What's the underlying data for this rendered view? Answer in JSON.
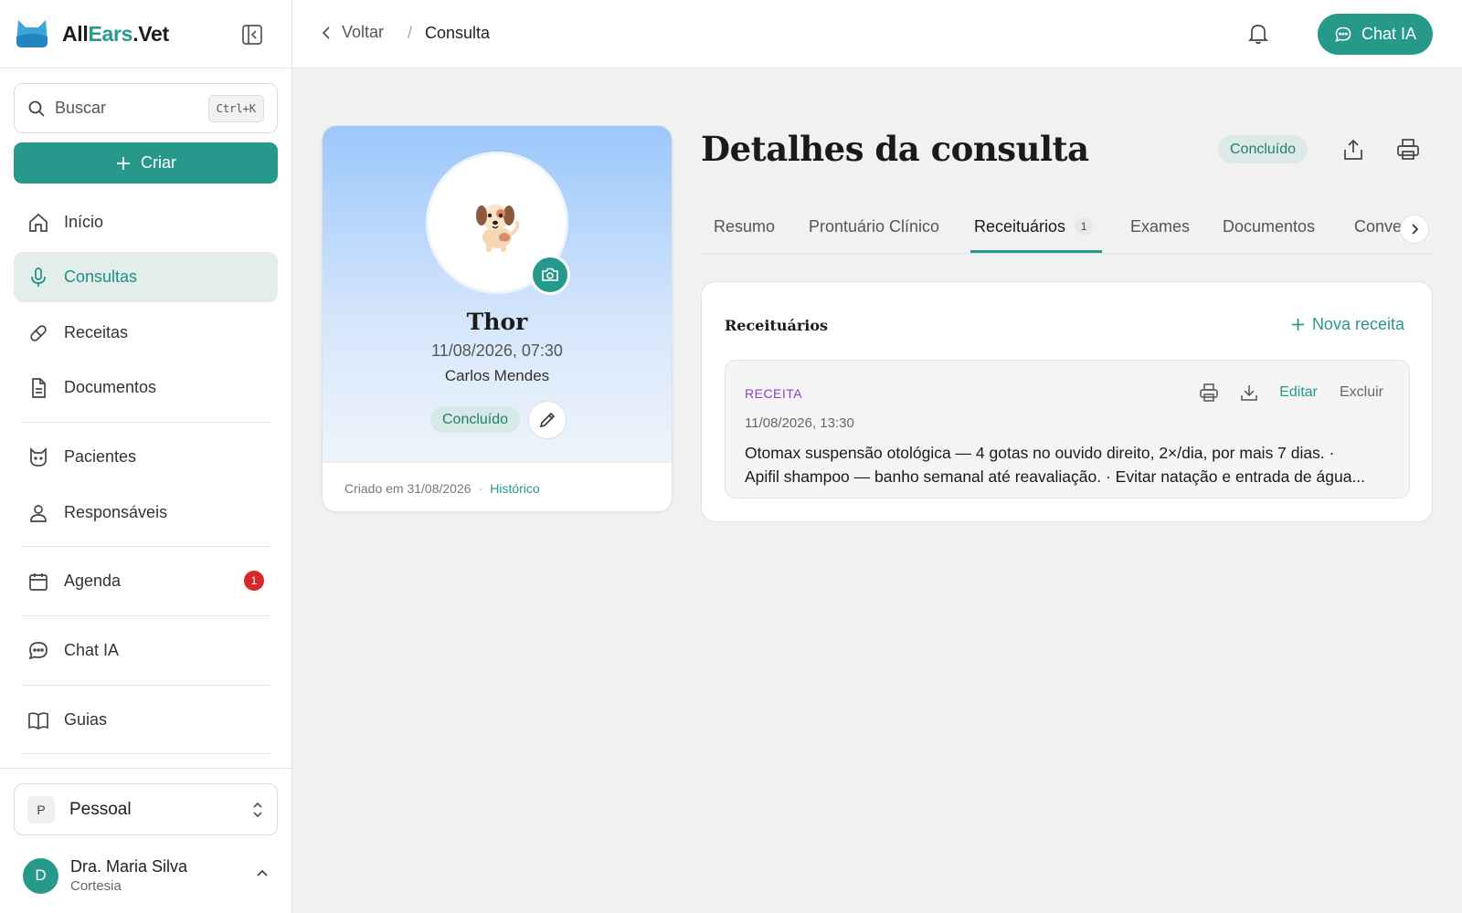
{
  "brand": {
    "name_part1": "All",
    "name_part2": "Ears",
    "name_part3": ".Vet"
  },
  "sidebar": {
    "search": {
      "placeholder": "Buscar",
      "shortcut": "Ctrl+K"
    },
    "create_label": "Criar",
    "items": [
      {
        "label": "Início",
        "icon": "home-icon"
      },
      {
        "label": "Consultas",
        "icon": "microphone-icon",
        "active": true
      },
      {
        "label": "Receitas",
        "icon": "pill-icon"
      },
      {
        "label": "Documentos",
        "icon": "document-icon"
      },
      {
        "label": "Pacientes",
        "icon": "cat-icon"
      },
      {
        "label": "Responsáveis",
        "icon": "user-icon"
      },
      {
        "label": "Agenda",
        "icon": "calendar-icon",
        "badge": "1"
      },
      {
        "label": "Chat IA",
        "icon": "chat-icon"
      },
      {
        "label": "Guias",
        "icon": "book-icon"
      }
    ],
    "workspace": {
      "letter": "P",
      "name": "Pessoal"
    },
    "user": {
      "initial": "D",
      "name": "Dra. Maria Silva",
      "plan": "Cortesia"
    }
  },
  "topbar": {
    "back_label": "Voltar",
    "separator": "/",
    "current": "Consulta",
    "chat_label": "Chat IA"
  },
  "pet": {
    "name": "Thor",
    "datetime": "11/08/2026, 07:30",
    "owner": "Carlos Mendes",
    "status": "Concluído",
    "created": "Criado em 31/08/2026",
    "dot": "·",
    "history_label": "Histórico"
  },
  "details": {
    "title": "Detalhes da consulta",
    "status": "Concluído",
    "tabs": [
      {
        "label": "Resumo"
      },
      {
        "label": "Prontuário Clínico"
      },
      {
        "label": "Receituários",
        "count": "1",
        "active": true
      },
      {
        "label": "Exames"
      },
      {
        "label": "Documentos"
      },
      {
        "label": "Conve"
      }
    ]
  },
  "prescriptions": {
    "title": "Receituários",
    "new_label": "Nova receita",
    "items": [
      {
        "kind": "RECEITA",
        "date": "11/08/2026, 13:30",
        "line1": "Otomax suspensão otológica — 4 gotas no ouvido direito, 2×/dia, por mais 7 dias. ·",
        "line2": "Apifil shampoo — banho semanal até reavaliação. · Evitar natação e entrada de água...",
        "edit_label": "Editar",
        "delete_label": "Excluir"
      }
    ]
  },
  "colors": {
    "accent": "#27998a",
    "active_bg": "#e3eeeb",
    "badge": "#d62828",
    "rx_kind": "#8a3fd1"
  }
}
